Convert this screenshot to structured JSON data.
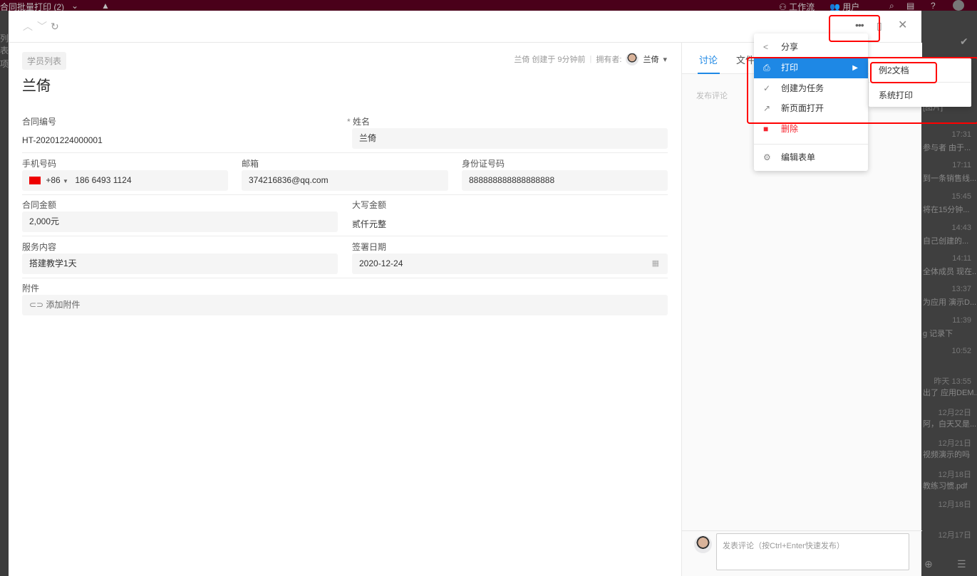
{
  "topbar": {
    "title": "合同批量打印 (2)",
    "workflow": "工作流",
    "users": "用户"
  },
  "left_strip": {
    "tab": "列表",
    "text": "项"
  },
  "right_strip": {
    "items": [
      {
        "time": "",
        "text": "[图片]"
      },
      {
        "time": "17:31",
        "text": "参与者 由于..."
      },
      {
        "time": "17:11",
        "text": "到一条销售线..."
      },
      {
        "time": "15:45",
        "text": "将在15分钟..."
      },
      {
        "time": "14:43",
        "text": "自己创建的..."
      },
      {
        "time": "14:11",
        "text": "全体成员 现在..."
      },
      {
        "time": "13:37",
        "text": "为应用 演示D..."
      },
      {
        "time": "11:39",
        "text": "g 记录下"
      },
      {
        "time": "10:52",
        "text": ""
      },
      {
        "time": "昨天 13:55",
        "text": "出了 应用DEM..."
      },
      {
        "time": "12月22日",
        "text": "阿，白天又是..."
      },
      {
        "time": "12月21日",
        "text": "视频演示的吗"
      },
      {
        "time": "12月18日",
        "text": "教练习惯.pdf"
      },
      {
        "time": "12月18日",
        "text": ""
      },
      {
        "time": "12月17日",
        "text": ""
      }
    ]
  },
  "record": {
    "tag": "学员列表",
    "title": "兰倚",
    "creator_meta": "兰倚 创建于 9分钟前",
    "owner_label": "拥有者:",
    "owner": "兰倚",
    "fields": {
      "contract_no": {
        "label": "合同编号",
        "value": "HT-20201224000001"
      },
      "name": {
        "label": "姓名",
        "value": "兰倚",
        "required_mark": "*"
      },
      "phone": {
        "label": "手机号码",
        "country_code": "+86",
        "value": "186 6493 1124"
      },
      "email": {
        "label": "邮箱",
        "value": "374216836@qq.com"
      },
      "id_no": {
        "label": "身份证号码",
        "value": "888888888888888888"
      },
      "amount": {
        "label": "合同金额",
        "value": "2,000元"
      },
      "amount_upper": {
        "label": "大写金额",
        "value": "贰仟元整"
      },
      "service": {
        "label": "服务内容",
        "value": "搭建教学1天"
      },
      "sign_date": {
        "label": "签署日期",
        "value": "2020-12-24"
      },
      "attachment": {
        "label": "附件",
        "button": "添加附件"
      }
    }
  },
  "side": {
    "tabs": [
      "讨论",
      "文件"
    ],
    "active_tab": "讨论",
    "post_label": "发布评论",
    "comment_placeholder": "发表评论（按Ctrl+Enter快速发布）"
  },
  "menu": {
    "items": [
      {
        "icon": "share-icon",
        "label": "分享"
      },
      {
        "icon": "print-icon",
        "label": "打印",
        "active": true
      },
      {
        "icon": "task-icon",
        "label": "创建为任务"
      },
      {
        "icon": "external-link-icon",
        "label": "新页面打开"
      },
      {
        "icon": "trash-icon",
        "label": "删除",
        "danger": true
      },
      {
        "icon": "gear-icon",
        "label": "编辑表单"
      }
    ]
  },
  "submenu": {
    "items": [
      "例2文档",
      "系统打印"
    ]
  },
  "colors": {
    "accent": "#1e88e5",
    "danger": "#f5222d",
    "highlight": "#ff0000"
  }
}
